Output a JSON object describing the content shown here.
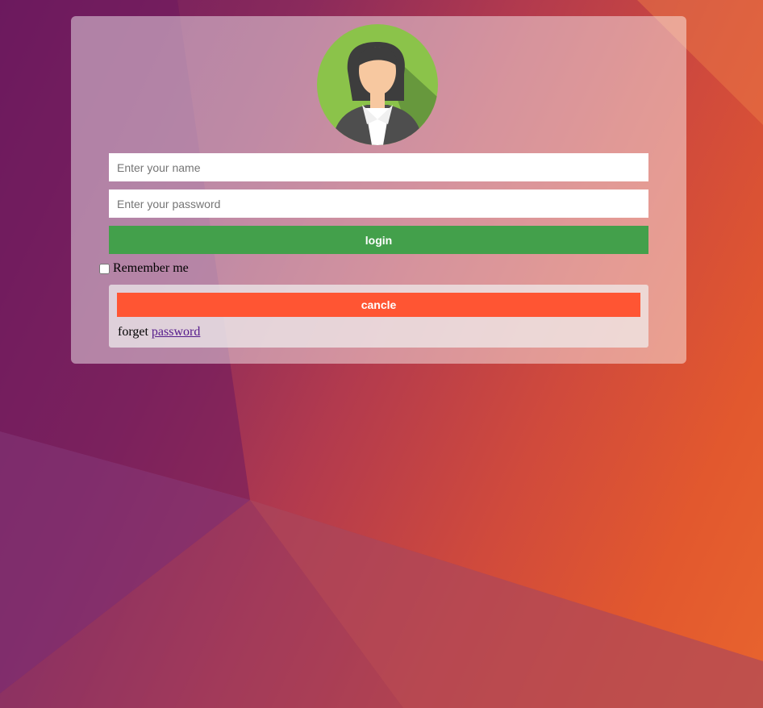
{
  "form": {
    "name_placeholder": "Enter your name",
    "password_placeholder": "Enter your password",
    "login_label": "login",
    "remember_label": "Remember me",
    "remember_checked": false,
    "cancel_label": "cancle",
    "forget_text": "forget",
    "password_link": "password"
  },
  "colors": {
    "login_button": "#43a04b",
    "cancel_button": "#ff5533",
    "avatar_bg": "#8bc34a",
    "link": "#551a8b"
  }
}
